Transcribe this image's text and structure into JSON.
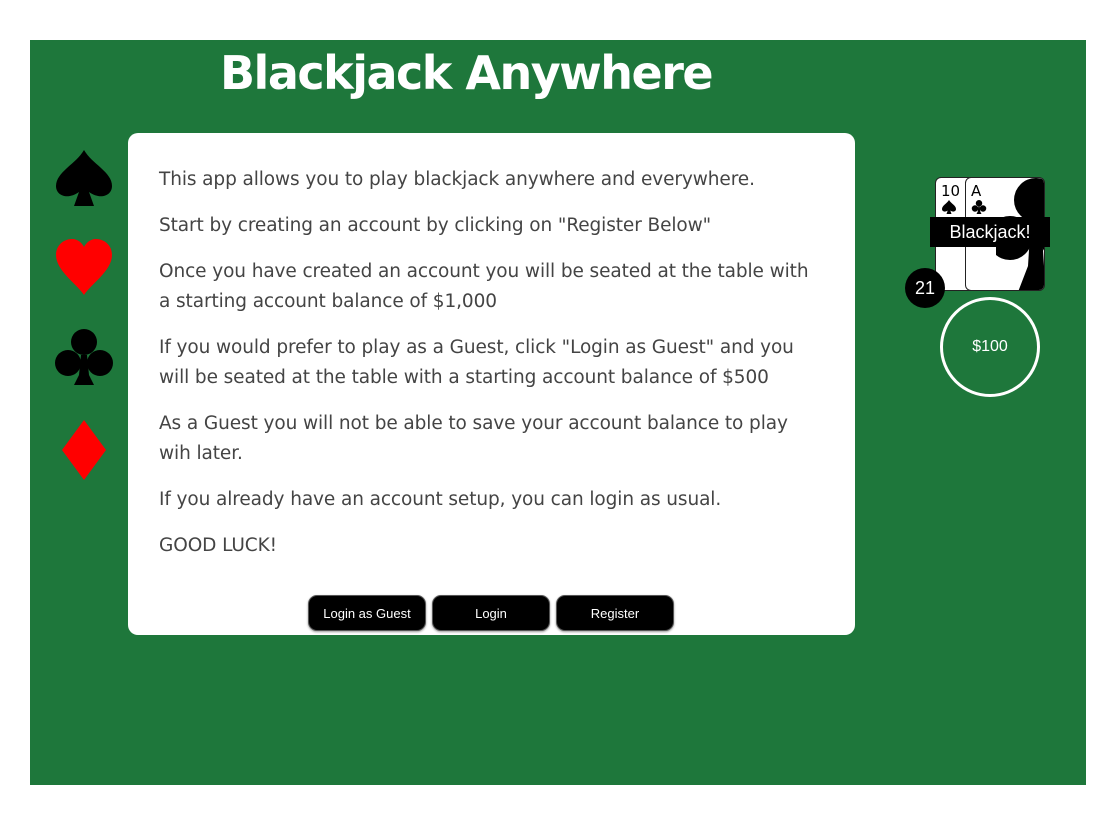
{
  "header": {
    "title": "Blackjack Anywhere"
  },
  "suits": [
    "spade-icon",
    "heart-icon",
    "club-icon",
    "diamond-icon"
  ],
  "colors": {
    "table": "#1e773b",
    "panel": "#ffffff",
    "text": "#444444",
    "button": "#000000",
    "red_suit": "#ff0000"
  },
  "info": {
    "paragraphs": [
      "This app allows you to play blackjack anywhere and everywhere.",
      "Start by creating an account by clicking on \"Register Below\"",
      "Once you have created an account you will be seated at the table with a starting account balance of $1,000",
      "If you would prefer to play as a Guest, click \"Login as Guest\" and you will be seated at the table with a starting account balance of $500",
      "As a Guest you will not be able to save your account balance to play wih later.",
      "If you already have an account setup, you can login as usual.",
      "GOOD LUCK!"
    ]
  },
  "buttons": {
    "guest_label": "Login as Guest",
    "login_label": "Login",
    "register_label": "Register"
  },
  "hand": {
    "cards": [
      {
        "rank": "10",
        "suit": "spade-icon"
      },
      {
        "rank": "A",
        "suit": "club-icon"
      }
    ],
    "result": "Blackjack!",
    "total": "21",
    "bet": "$100"
  }
}
